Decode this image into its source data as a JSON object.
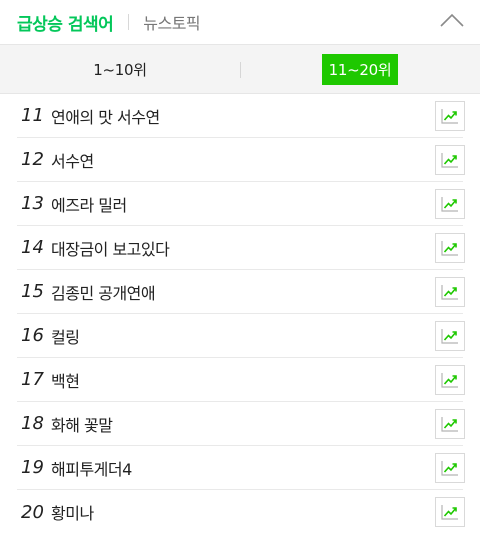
{
  "header": {
    "main_tab": "급상승 검색어",
    "news_tab": "뉴스토픽",
    "collapse_icon": "chevron-up-icon"
  },
  "subtabs": [
    {
      "label": "1~10위",
      "active": false
    },
    {
      "label": "11~20위",
      "active": true
    }
  ],
  "accent_color": "#1ec800",
  "trend_icon": "trend-chart-icon",
  "items": [
    {
      "rank": "11",
      "keyword": "연애의 맛 서수연"
    },
    {
      "rank": "12",
      "keyword": "서수연"
    },
    {
      "rank": "13",
      "keyword": "에즈라 밀러"
    },
    {
      "rank": "14",
      "keyword": "대장금이 보고있다"
    },
    {
      "rank": "15",
      "keyword": "김종민 공개연애"
    },
    {
      "rank": "16",
      "keyword": "컬링"
    },
    {
      "rank": "17",
      "keyword": "백현"
    },
    {
      "rank": "18",
      "keyword": "화해 꽃말"
    },
    {
      "rank": "19",
      "keyword": "해피투게더4"
    },
    {
      "rank": "20",
      "keyword": "황미나"
    }
  ]
}
